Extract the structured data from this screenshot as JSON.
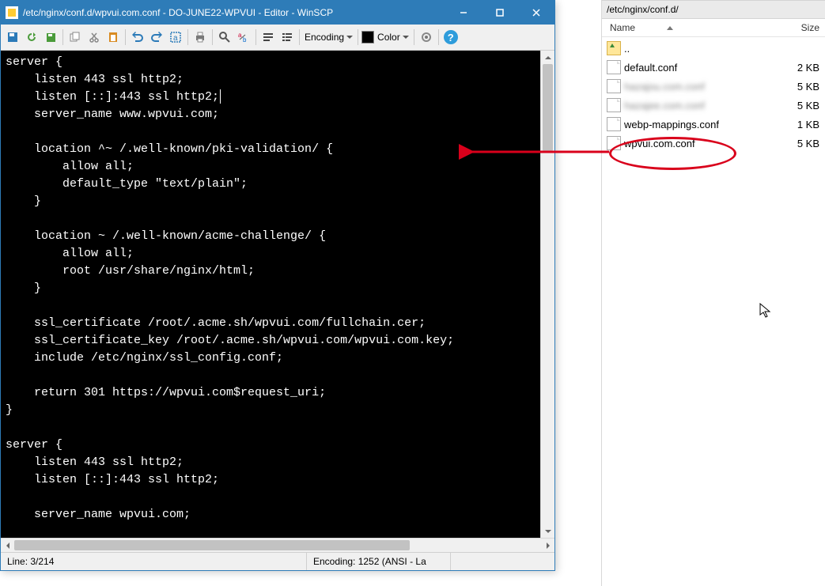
{
  "window": {
    "title": "/etc/nginx/conf.d/wpvui.com.conf - DO-JUNE22-WPVUI - Editor - WinSCP"
  },
  "toolbar": {
    "encoding_label": "Encoding",
    "color_label": "Color",
    "help_label": "?"
  },
  "code": {
    "lines": [
      "server {",
      "    listen 443 ssl http2;",
      "    listen [::]:443 ssl http2;",
      "    server_name www.wpvui.com;",
      "",
      "    location ^~ /.well-known/pki-validation/ {",
      "        allow all;",
      "        default_type \"text/plain\";",
      "    }",
      "",
      "    location ~ /.well-known/acme-challenge/ {",
      "        allow all;",
      "        root /usr/share/nginx/html;",
      "    }",
      "",
      "    ssl_certificate /root/.acme.sh/wpvui.com/fullchain.cer;",
      "    ssl_certificate_key /root/.acme.sh/wpvui.com/wpvui.com.key;",
      "    include /etc/nginx/ssl_config.conf;",
      "",
      "    return 301 https://wpvui.com$request_uri;",
      "}",
      "",
      "server {",
      "    listen 443 ssl http2;",
      "    listen [::]:443 ssl http2;",
      "",
      "    server_name wpvui.com;"
    ],
    "caret_line_index": 2
  },
  "status": {
    "line": "Line: 3/214",
    "encoding": "Encoding: 1252  (ANSI - La"
  },
  "filepanel": {
    "path": "/etc/nginx/conf.d/",
    "header_name": "Name",
    "header_size": "Size",
    "up_label": "..",
    "rows": [
      {
        "name": "default.conf",
        "size": "2 KB",
        "blur": false
      },
      {
        "name": "hazajou.com.conf",
        "size": "5 KB",
        "blur": true
      },
      {
        "name": "hazajee.com.conf",
        "size": "5 KB",
        "blur": true
      },
      {
        "name": "webp-mappings.conf",
        "size": "1 KB",
        "blur": false
      },
      {
        "name": "wpvui.com.conf",
        "size": "5 KB",
        "blur": false
      }
    ]
  }
}
